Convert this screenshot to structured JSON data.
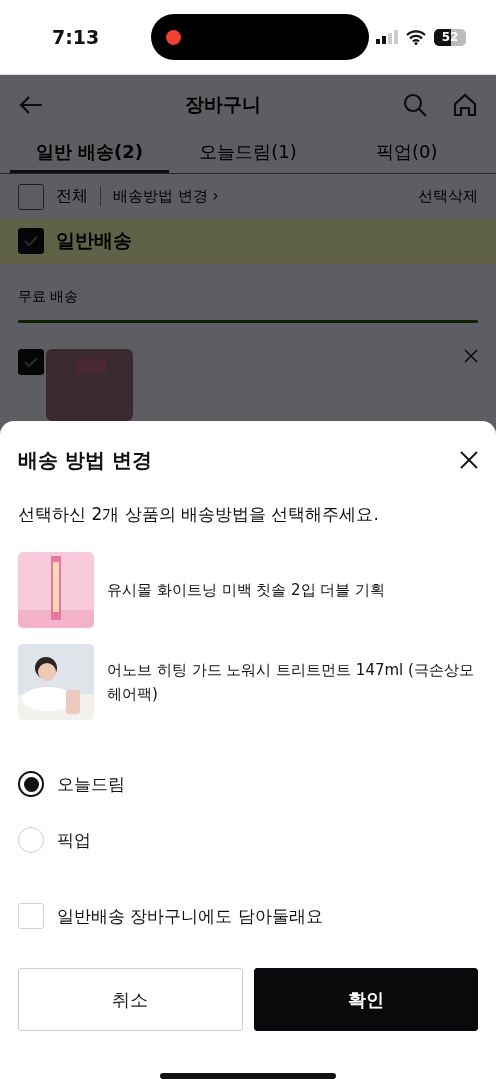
{
  "status_bar": {
    "time": "7:13",
    "battery": "52"
  },
  "header": {
    "title": "장바구니"
  },
  "tabs": [
    {
      "label": "일반 배송(2)",
      "selected": true
    },
    {
      "label": "오늘드림(1)",
      "selected": false
    },
    {
      "label": "픽업(0)",
      "selected": false
    }
  ],
  "toolbar": {
    "select_all": {
      "label": "전체",
      "checked": false
    },
    "change_method": "배송방법 변경 ›",
    "delete_selected": "선택삭제"
  },
  "section": {
    "label": "일반배송",
    "checked": true
  },
  "free_shipping": {
    "label": "무료 배송",
    "level": 1
  },
  "cart_items": [
    {
      "checked": true,
      "kind": "picture"
    }
  ],
  "sheet": {
    "title": "배송 방법 변경",
    "message": "선택하신 2개 상품의 배송방법을 선택해주세요.",
    "products": [
      {
        "name": "유시몰 화이트닝 미백 칫솔 2입 더블 기획",
        "kind": "pink"
      },
      {
        "name": "어노브 히팅 가드 노워시 트리트먼트 147ml (극손상모 헤어팩)",
        "kind": "person"
      }
    ],
    "options": [
      {
        "label": "오늘드림",
        "selected": true
      },
      {
        "label": "픽업",
        "selected": false
      }
    ],
    "keep_in_cart": {
      "label": "일반배송 장바구니에도 담아둘래요",
      "checked": false
    },
    "buttons": [
      {
        "label": "취소",
        "kind": "secondary"
      },
      {
        "label": "확인",
        "kind": "primary"
      }
    ]
  }
}
